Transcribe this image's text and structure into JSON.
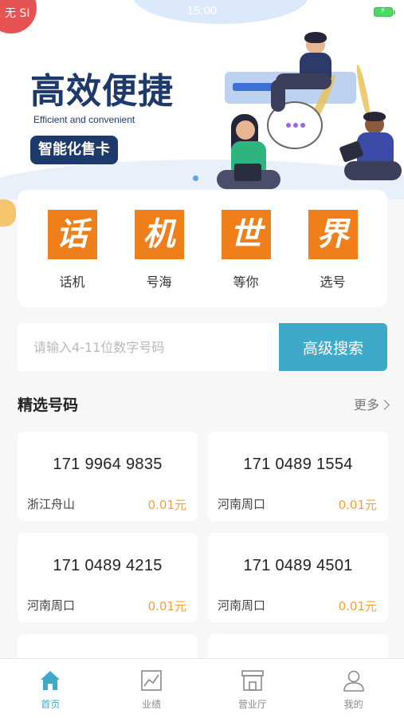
{
  "status_bar": {
    "carrier": "无 SI",
    "time": "15:00"
  },
  "banner": {
    "title": "高效便捷",
    "subtitle": "Efficient and convenient",
    "tag": "智能化售卡"
  },
  "categories": [
    {
      "glyph": "话",
      "label": "话机"
    },
    {
      "glyph": "机",
      "label": "号海"
    },
    {
      "glyph": "世",
      "label": "等你"
    },
    {
      "glyph": "界",
      "label": "选号"
    }
  ],
  "search": {
    "placeholder": "请输入4-11位数字号码",
    "value": "",
    "button_label": "高级搜索"
  },
  "section": {
    "title": "精选号码",
    "more_label": "更多"
  },
  "numbers": [
    {
      "number": "171 9964 9835",
      "location": "浙江舟山",
      "price": "0.01元"
    },
    {
      "number": "171 0489 1554",
      "location": "河南周口",
      "price": "0.01元"
    },
    {
      "number": "171 0489 4215",
      "location": "河南周口",
      "price": "0.01元"
    },
    {
      "number": "171 0489 4501",
      "location": "河南周口",
      "price": "0.01元"
    }
  ],
  "tabbar": [
    {
      "label": "首页",
      "icon": "home-icon",
      "active": true
    },
    {
      "label": "业绩",
      "icon": "chart-icon",
      "active": false
    },
    {
      "label": "营业厅",
      "icon": "store-icon",
      "active": false
    },
    {
      "label": "我的",
      "icon": "user-icon",
      "active": false
    }
  ],
  "colors": {
    "accent": "#3fa9c9",
    "orange": "#ef7f1a",
    "price": "#f0a23a",
    "navy": "#1e3a6b"
  }
}
